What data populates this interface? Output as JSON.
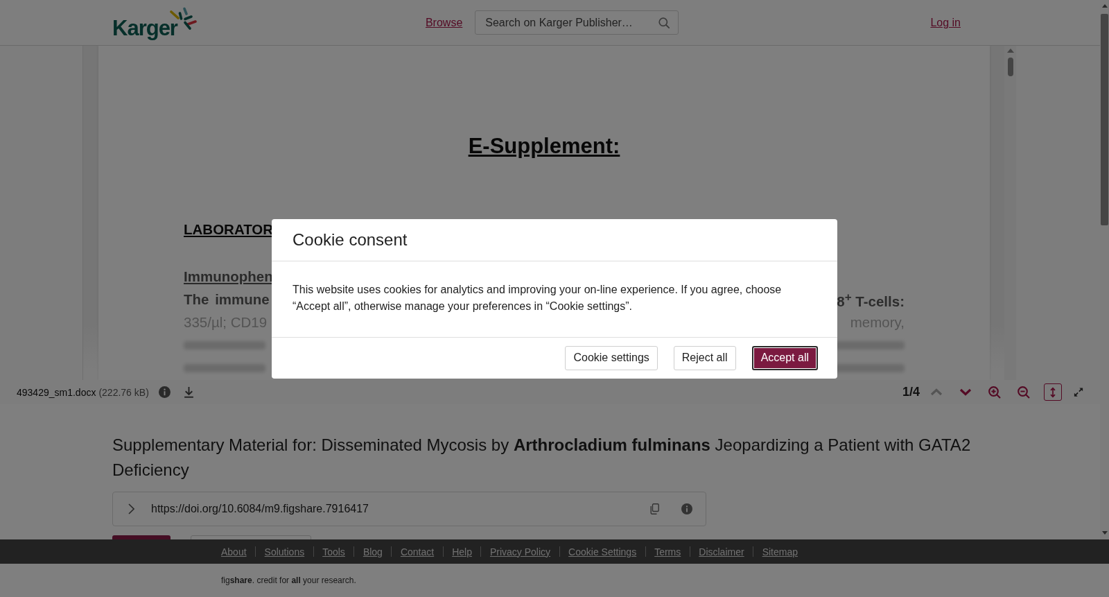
{
  "header": {
    "logo": "Karger",
    "browse_link": "Browse",
    "search": {
      "placeholder": "Search on Karger Publisher…"
    },
    "login_link": "Log in"
  },
  "document": {
    "heading": "E-Supplement:",
    "lines": [
      {
        "kind": "section",
        "left": "LABORATOR"
      },
      {
        "kind": "subsection",
        "left": "Immunophen"
      },
      {
        "kind": "bold",
        "left": "The immune",
        "right": "8$^{+}$ T-cells:"
      },
      {
        "kind": "faded",
        "left": "335/µl; CD19",
        "right": "memory,"
      },
      {
        "kind": "blurred"
      },
      {
        "kind": "blurred"
      }
    ]
  },
  "viewer_toolbar": {
    "file_name": "493429_sm1.docx",
    "file_size": "(222.76 kB)",
    "page_indicator": "1/4",
    "controls": [
      {
        "kind": "prev-page",
        "disabled": true,
        "on": false
      },
      {
        "kind": "next-page",
        "disabled": false,
        "on": false
      },
      {
        "kind": "zoom-in",
        "disabled": false,
        "on": false
      },
      {
        "kind": "zoom-out",
        "disabled": false,
        "on": false
      },
      {
        "kind": "fit-height",
        "disabled": false,
        "on": true
      },
      {
        "kind": "fullscreen",
        "disabled": false,
        "on": false
      }
    ]
  },
  "article": {
    "title": "Supplementary Material for: Disseminated Mycosis by **Arthrocladium fulminans** Jeopardizing a Patient with GATA2 Deficiency",
    "doi_url": "https://doi.org/10.6084/m9.figshare.7916417",
    "action_buttons": [
      {
        "kind": "primary"
      },
      {
        "kind": "outlined"
      }
    ]
  },
  "footer": {
    "links": [
      "About",
      "Solutions",
      "Tools",
      "Blog",
      "Contact",
      "Help",
      "Privacy Policy",
      "Cookie Settings",
      "Terms",
      "Disclaimer",
      "Sitemap"
    ],
    "credit": "fig**share**. credit for **all** your research."
  },
  "cookie_modal": {
    "title": "Cookie consent",
    "message": "This website uses cookies for analytics and improving your on-line experience. If you agree, choose “Accept all”, otherwise manage your preferences in “Cookie settings”.",
    "buttons": [
      {
        "label": "Cookie settings",
        "kind": "secondary",
        "focused": false
      },
      {
        "label": "Reject all",
        "kind": "secondary",
        "focused": false
      },
      {
        "label": "Accept all",
        "kind": "primary",
        "focused": true
      }
    ]
  }
}
